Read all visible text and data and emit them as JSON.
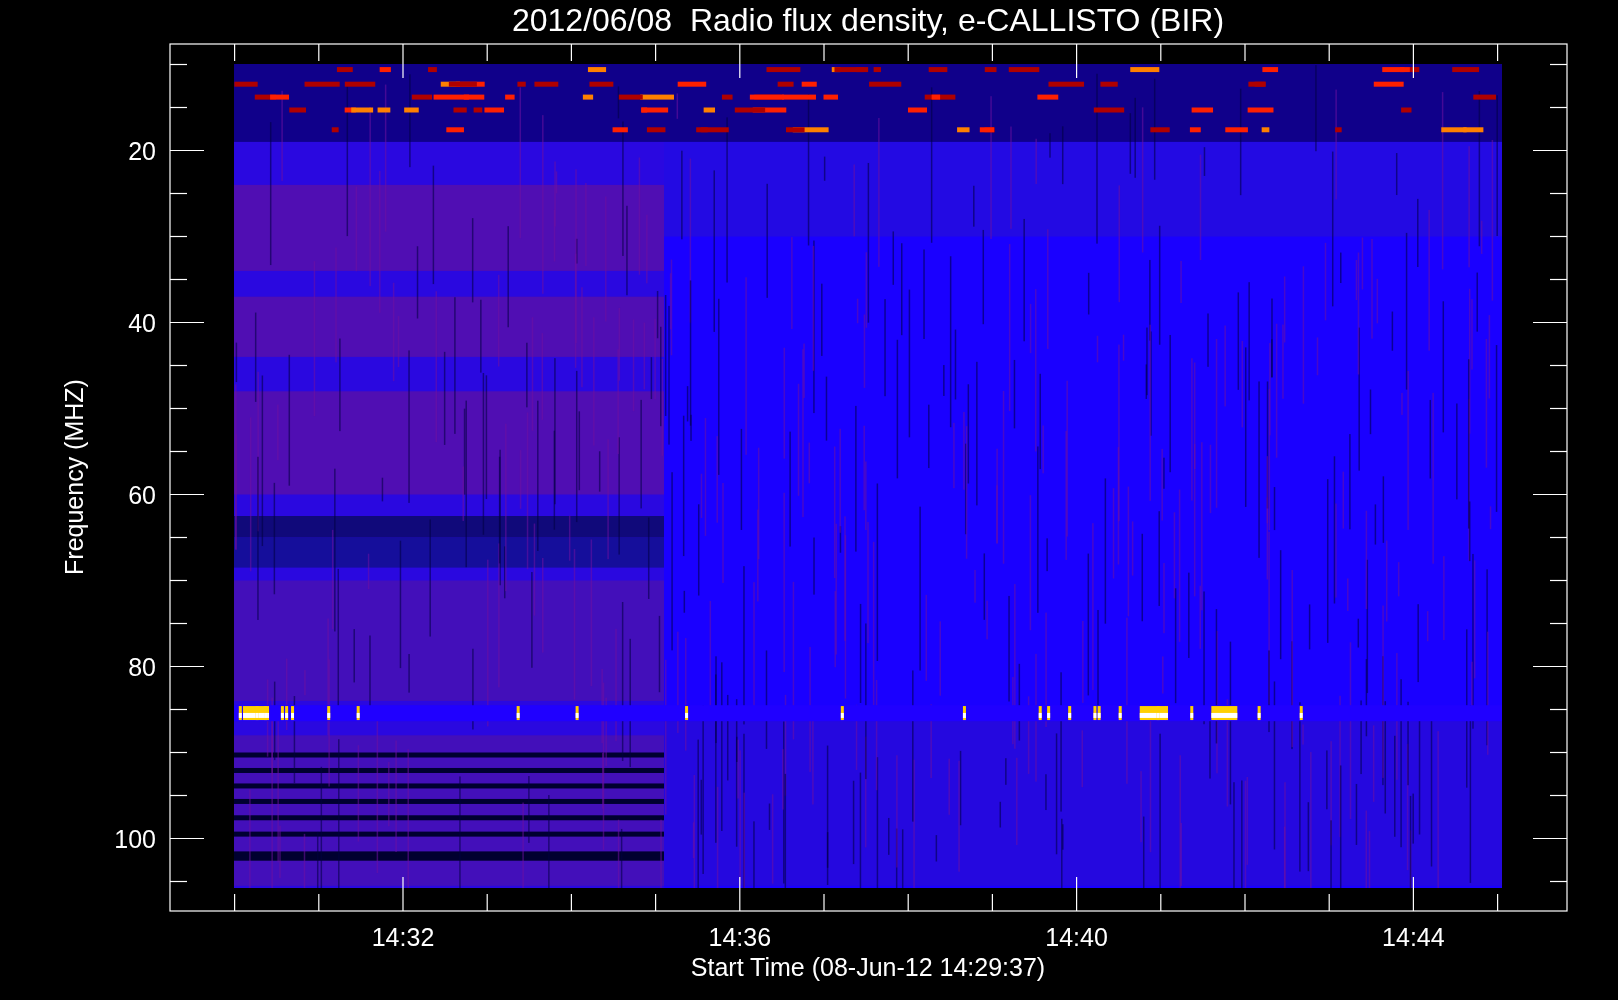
{
  "title": "2012/06/08  Radio flux density, e-CALLISTO (BIR)",
  "y_axis": {
    "label": "Frequency (MHZ)",
    "ticks": [
      "20",
      "40",
      "60",
      "80",
      "100"
    ]
  },
  "x_axis": {
    "label": "Start Time (08-Jun-12 14:29:37)",
    "ticks": [
      "14:32",
      "14:36",
      "14:40",
      "14:44"
    ]
  }
}
